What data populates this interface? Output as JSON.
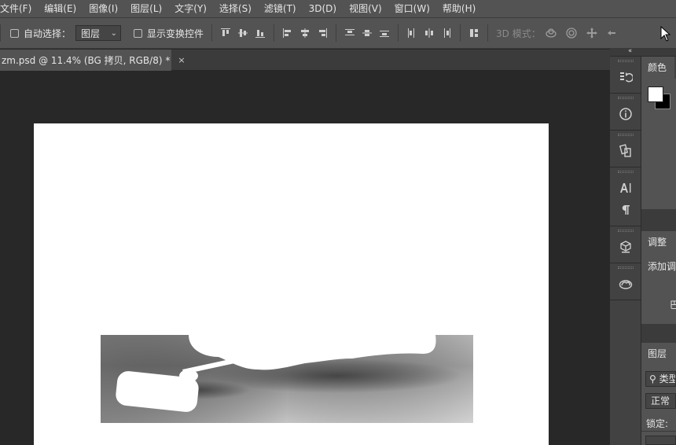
{
  "menu": [
    "文件(F)",
    "编辑(E)",
    "图像(I)",
    "图层(L)",
    "文字(Y)",
    "选择(S)",
    "滤镜(T)",
    "3D(D)",
    "视图(V)",
    "窗口(W)",
    "帮助(H)"
  ],
  "options": {
    "auto_select_label": "自动选择：",
    "auto_select_value": "图层",
    "show_transform_label": "显示变换控件",
    "mode_label": "3D 模式：",
    "align_icons": [
      "align-top-icon",
      "align-vcenter-icon",
      "align-bottom-icon",
      "align-left-icon",
      "align-hcenter-icon",
      "align-right-icon",
      "distribute-top-icon",
      "distribute-vcenter-icon",
      "distribute-bottom-icon",
      "distribute-left-icon",
      "distribute-hcenter-icon",
      "distribute-right-icon",
      "auto-align-icon"
    ],
    "mode_icons": [
      "orbit-3d-icon",
      "roll-3d-icon",
      "pan-3d-icon",
      "slide-3d-icon"
    ]
  },
  "document": {
    "tab_title": "zm.psd @ 11.4% (BG 拷贝, RGB/8) *",
    "close_glyph": "×"
  },
  "panels": {
    "color_tab": "颜色",
    "adjust_tab": "调整",
    "adjust_hint": "添加调",
    "adjust_more": "巴",
    "layers_tab": "图层",
    "kind_search": "类型",
    "blend_mode": "正常",
    "lock_label": "锁定:",
    "side_icons": [
      "history-icon",
      "info-icon",
      "properties-icon",
      "character-icon",
      "paragraph-icon",
      "3d-icon",
      "libraries-icon"
    ]
  },
  "colors": {
    "foreground": "#ffffff",
    "background": "#000000",
    "ui_gray": "#535353",
    "workspace": "#282828"
  }
}
